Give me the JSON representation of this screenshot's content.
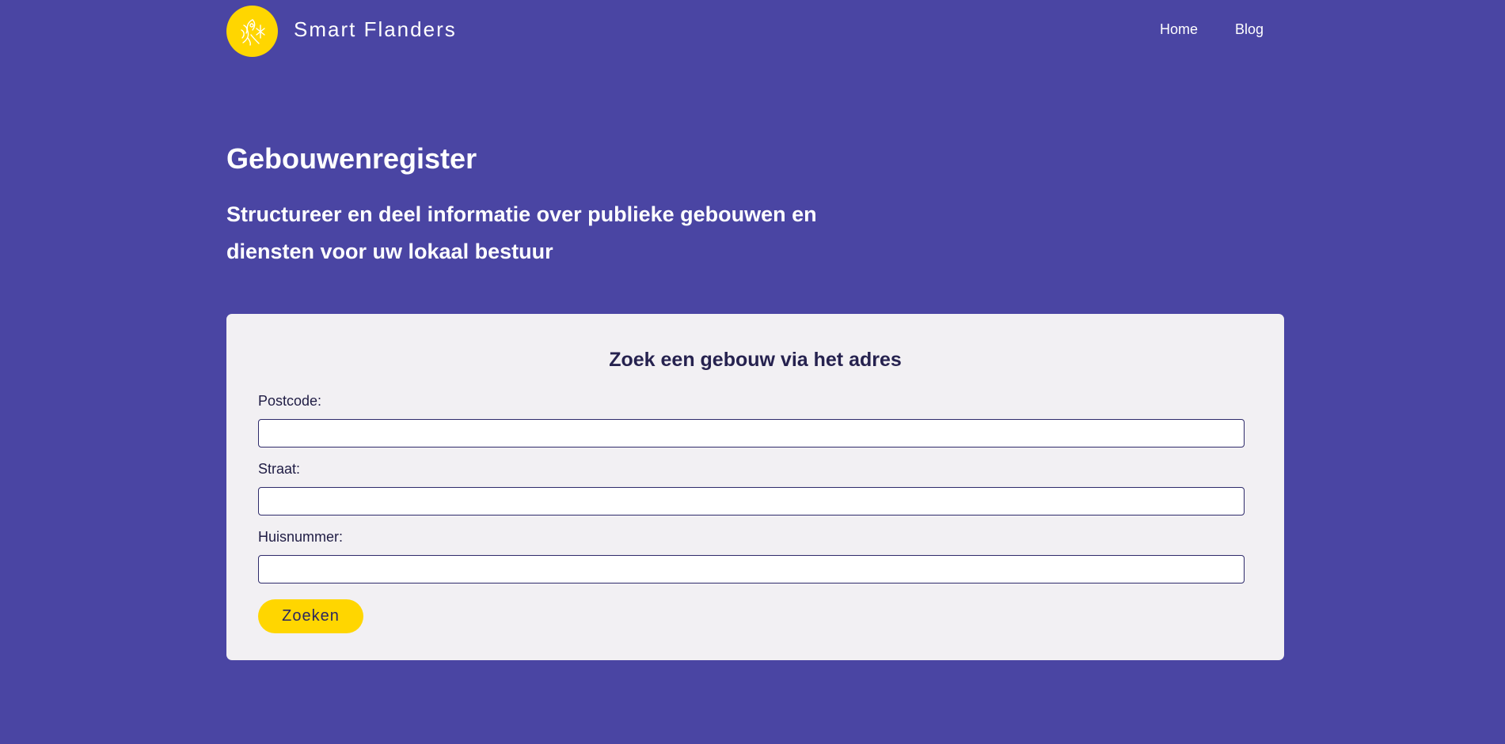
{
  "header": {
    "brand": "Smart Flanders",
    "nav": [
      {
        "label": "Home"
      },
      {
        "label": "Blog"
      }
    ],
    "logo_icon": "lion-emblem-icon"
  },
  "hero": {
    "title": "Gebouwenregister",
    "subtitle": "Structureer en deel informatie over publieke gebouwen en diensten voor uw lokaal bestuur"
  },
  "search_form": {
    "title": "Zoek een gebouw via het adres",
    "fields": [
      {
        "label": "Postcode:",
        "value": "",
        "placeholder": ""
      },
      {
        "label": "Straat:",
        "value": "",
        "placeholder": ""
      },
      {
        "label": "Huisnummer:",
        "value": "",
        "placeholder": ""
      }
    ],
    "submit_label": "Zoeken"
  },
  "colors": {
    "background": "#4a45a3",
    "accent": "#ffd600",
    "card": "#f2f0f3",
    "text_dark": "#26224f"
  }
}
